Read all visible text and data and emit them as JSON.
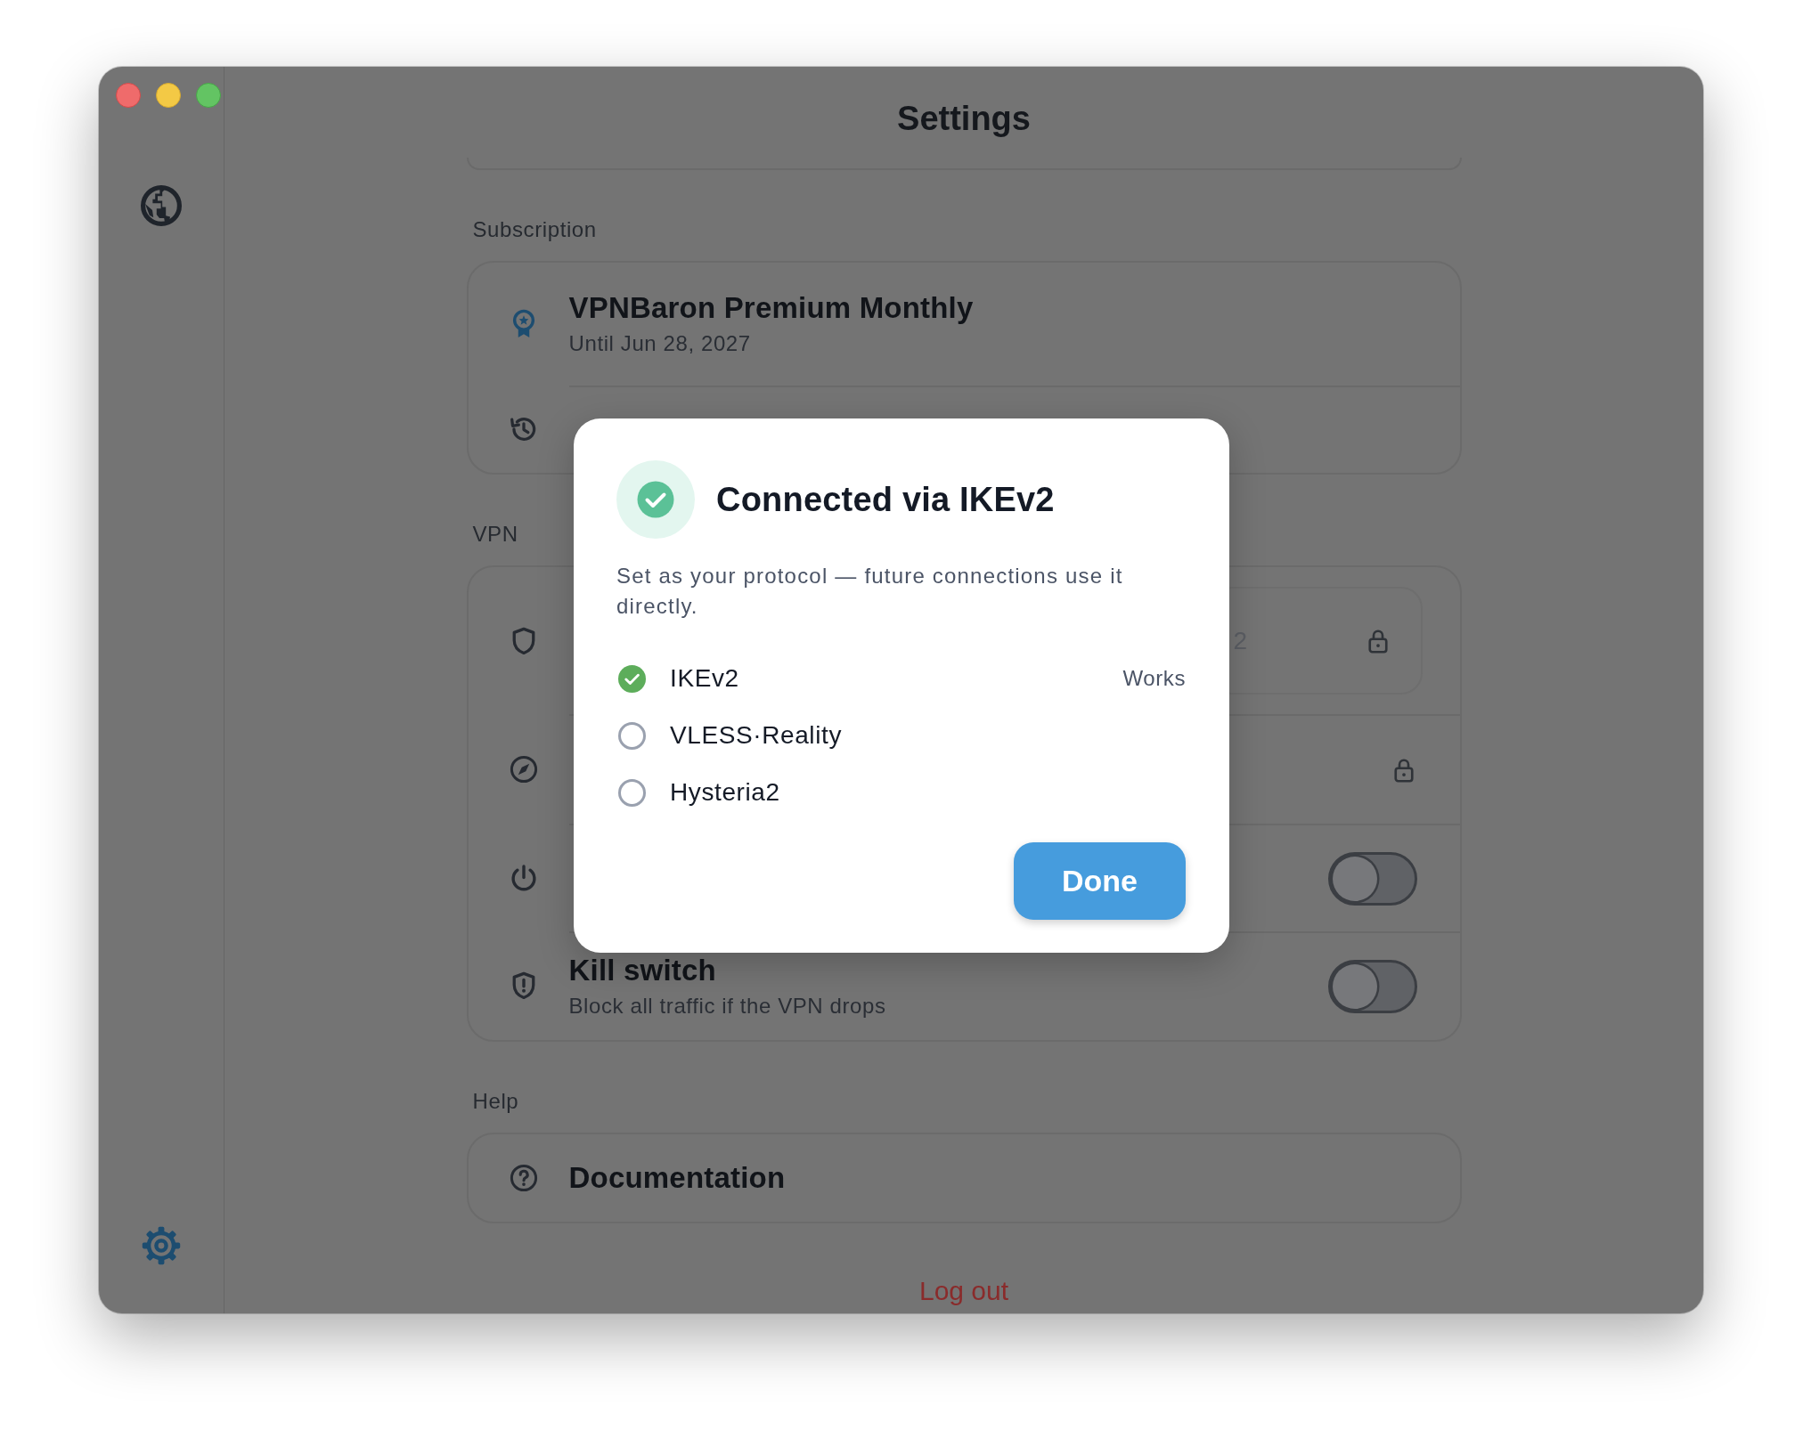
{
  "window": {
    "title": "Settings"
  },
  "sidebar": {
    "main": [
      {
        "selected": false
      }
    ],
    "footer": [
      {
        "selected": true
      }
    ]
  },
  "sections": [
    {
      "label": "Subscription",
      "rows": [
        {
          "kind": "plan",
          "title": "VPNBaron Premium Monthly",
          "subtitle": "Until Jun 28, 2027"
        },
        {
          "kind": "nav"
        }
      ]
    },
    {
      "label": "VPN",
      "rows": [
        {
          "kind": "field",
          "value": "2",
          "locked": true
        },
        {
          "kind": "lock",
          "locked": true
        },
        {
          "kind": "toggle",
          "on": false
        },
        {
          "kind": "toggle",
          "title": "Kill switch",
          "subtitle": "Block all traffic if the VPN drops",
          "on": false
        }
      ]
    },
    {
      "label": "Help",
      "rows": [
        {
          "kind": "nav",
          "title": "Documentation"
        }
      ]
    }
  ],
  "log_out": "Log out",
  "dialog": {
    "title": "Connected via IKEv2",
    "message": "Set as your protocol — future connections use it directly.",
    "options": [
      {
        "label": "IKEv2",
        "selected": true,
        "status": "Works"
      },
      {
        "label": "VLESS·Reality",
        "selected": false
      },
      {
        "label": "Hysteria2",
        "selected": false
      }
    ],
    "button": "Done"
  }
}
